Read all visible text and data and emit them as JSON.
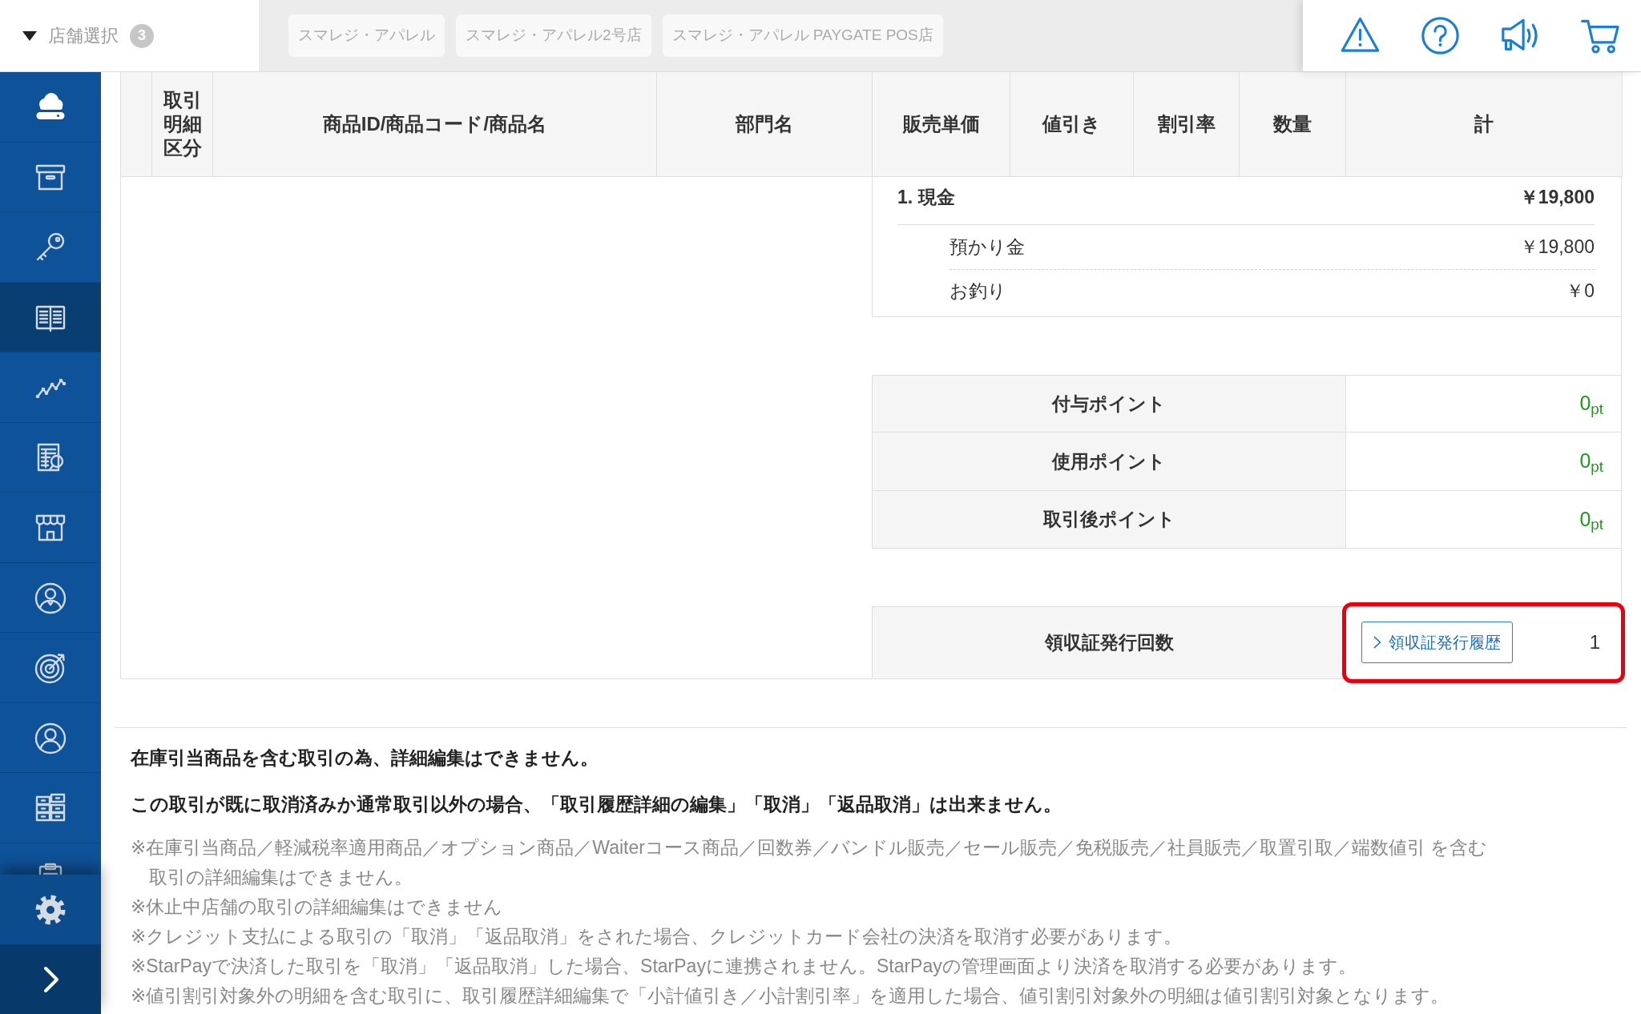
{
  "top_bar": {
    "store_selector": {
      "label": "店舗選択",
      "count": "3"
    },
    "store_tabs": [
      {
        "label": "スマレジ・アパレル"
      },
      {
        "label": "スマレジ・アパレル2号店"
      },
      {
        "label": "スマレジ・アパレル PAYGATE POS店"
      }
    ],
    "actions": [
      {
        "kind": "warning"
      },
      {
        "kind": "help"
      },
      {
        "kind": "announcement"
      },
      {
        "kind": "cart"
      }
    ]
  },
  "sidebar": {
    "items": [
      {
        "kind": "cloud",
        "selected": false
      },
      {
        "kind": "archive",
        "selected": false
      },
      {
        "kind": "key",
        "selected": false
      },
      {
        "kind": "book",
        "selected": true
      },
      {
        "kind": "chart",
        "selected": false
      },
      {
        "kind": "report",
        "selected": false
      },
      {
        "kind": "store",
        "selected": false
      },
      {
        "kind": "staff",
        "selected": false
      },
      {
        "kind": "target",
        "selected": false
      },
      {
        "kind": "member",
        "selected": false
      },
      {
        "kind": "drawers",
        "selected": false
      },
      {
        "kind": "clipboard",
        "selected": false
      }
    ],
    "footer": [
      {
        "kind": "settings"
      },
      {
        "kind": "expand"
      }
    ]
  },
  "table": {
    "columns": [
      "取引明細区分",
      "商品ID/商品コード/商品名",
      "部門名",
      "販売単価",
      "値引き",
      "割引率",
      "数量",
      "計"
    ]
  },
  "payment": {
    "method": "1. 現金",
    "amount": "￥19,800",
    "lines": [
      {
        "label": "預かり金",
        "amount": "￥19,800"
      },
      {
        "label": "お釣り",
        "amount": "￥0"
      }
    ]
  },
  "points": [
    {
      "label": "付与ポイント",
      "value": "0$_{pt}$"
    },
    {
      "label": "使用ポイント",
      "value": "0$_{pt}$"
    },
    {
      "label": "取引後ポイント",
      "value": "0$_{pt}$"
    }
  ],
  "receipt": {
    "label": "領収証発行回数",
    "button": "領収証発行履歴",
    "count": "1",
    "highlighted": true
  },
  "notices": [
    "在庫引当商品を含む取引の為、詳細編集はできません。",
    "この取引が既に取消済みか通常取引以外の場合、「取引履歴詳細の編集」「取消」「返品取消」は出来ません。"
  ],
  "notes": [
    "※在庫引当商品／軽減税率適用商品／オプション商品／Waiterコース商品／回数券／バンドル販売／セール販売／免税販売／社員販売／取置引取／端数値引 を含む取引の詳細編集はできません。",
    "※休止中店舗の取引の詳細編集はできません",
    "※クレジット支払による取引の「取消」「返品取消」をされた場合、クレジットカード会社の決済を取消す必要があります。",
    "※StarPayで決済した取引を「取消」「返品取消」した場合、StarPayに連携されません。StarPayの管理画面より決済を取消する必要があります。",
    "※値引割引対象外の明細を含む取引に、取引履歴詳細編集で「小計値引き／小計割引率」を適用した場合、値引割引対象外の明細は値引割引対象となります。"
  ]
}
